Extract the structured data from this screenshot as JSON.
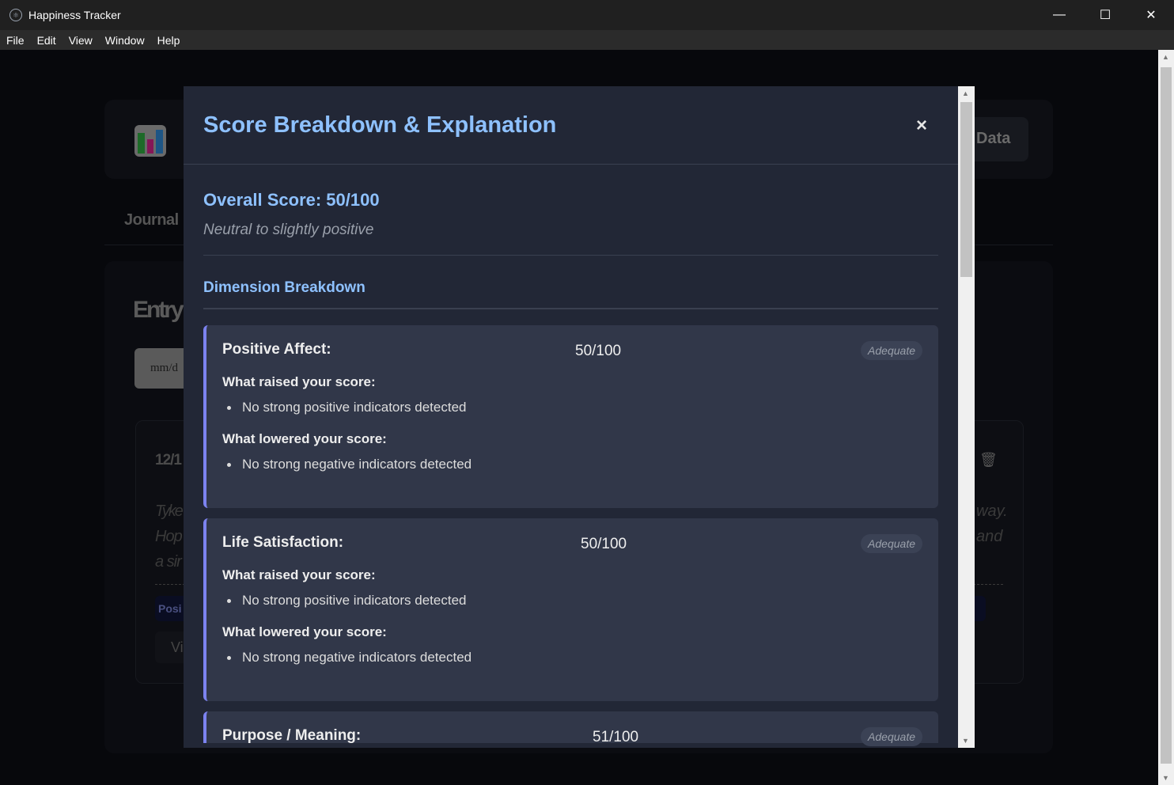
{
  "window": {
    "title": "Happiness Tracker",
    "minimize": "—",
    "maximize": "☐",
    "close": "✕"
  },
  "menu": [
    "File",
    "Edit",
    "View",
    "Window",
    "Help"
  ],
  "background": {
    "header_button": "Data",
    "tab": "Journal",
    "heading": "Entry",
    "date_placeholder": "mm/d",
    "entry_date": "12/1",
    "entry_lines_left": [
      "Tyke",
      "Hop",
      "a sir"
    ],
    "entry_lines_right": [
      "way.",
      "and"
    ],
    "tag": "Posi",
    "button": "Vi"
  },
  "modal": {
    "title": "Score Breakdown & Explanation",
    "close": "×",
    "overall": "Overall Score: 50/100",
    "summary": "Neutral to slightly positive",
    "section": "Dimension Breakdown",
    "dimensions": [
      {
        "name": "Positive Affect:",
        "score": "50/100",
        "badge": "Adequate",
        "raised_label": "What raised your score:",
        "raised": "No strong positive indicators detected",
        "lowered_label": "What lowered your score:",
        "lowered": "No strong negative indicators detected"
      },
      {
        "name": "Life Satisfaction:",
        "score": "50/100",
        "badge": "Adequate",
        "raised_label": "What raised your score:",
        "raised": "No strong positive indicators detected",
        "lowered_label": "What lowered your score:",
        "lowered": "No strong negative indicators detected"
      },
      {
        "name": "Purpose / Meaning:",
        "score": "51/100",
        "badge": "Adequate"
      }
    ]
  }
}
